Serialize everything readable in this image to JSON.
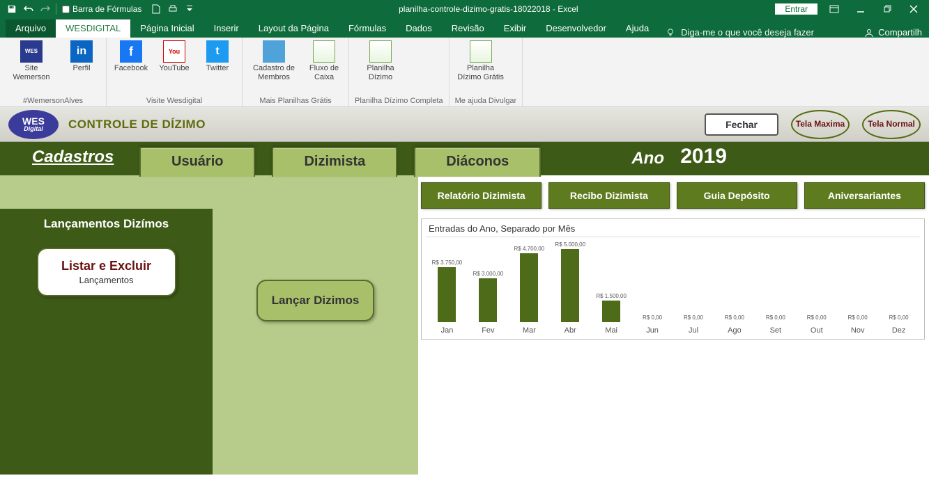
{
  "titlebar": {
    "formula_checkbox_label": "Barra de Fórmulas",
    "document_title": "planilha-controle-dizimo-gratis-18022018  -  Excel",
    "signin": "Entrar"
  },
  "tabs": {
    "file": "Arquivo",
    "active": "WESDIGITAL",
    "others": [
      "Página Inicial",
      "Inserir",
      "Layout da Página",
      "Fórmulas",
      "Dados",
      "Revisão",
      "Exibir",
      "Desenvolvedor",
      "Ajuda"
    ],
    "tellme": "Diga-me o que você deseja fazer",
    "share": "Compartilh"
  },
  "ribbon": {
    "groups": [
      {
        "label": "#WemersonAlves",
        "items": [
          {
            "name": "Site Wemerson",
            "iconText": "WES",
            "cls": "ic-wes",
            "wide": true
          },
          {
            "name": "Perfil",
            "iconText": "in",
            "cls": "ic-in"
          }
        ]
      },
      {
        "label": "Visite Wesdigital",
        "items": [
          {
            "name": "Facebook",
            "iconText": "f",
            "cls": "ic-fb"
          },
          {
            "name": "YouTube",
            "iconText": "You",
            "cls": "ic-yt"
          },
          {
            "name": "Twitter",
            "iconText": "t",
            "cls": "ic-tw"
          }
        ]
      },
      {
        "label": "Mais Planilhas Grátis",
        "items": [
          {
            "name": "Cadastro de Membros",
            "iconText": "",
            "cls": "ic-blue",
            "wide": true
          },
          {
            "name": "Fluxo de Caixa",
            "iconText": "",
            "cls": "ic-sheet"
          }
        ]
      },
      {
        "label": "Planilha Dízimo Completa",
        "items": [
          {
            "name": "Planilha Dízimo",
            "iconText": "",
            "cls": "ic-sheet",
            "wide": true
          }
        ]
      },
      {
        "label": "Me ajuda Divulgar",
        "items": [
          {
            "name": "Planilha Dízimo Grátis",
            "iconText": "",
            "cls": "ic-sheet",
            "wide": true
          }
        ]
      }
    ]
  },
  "sheet_header": {
    "logo_main": "WES",
    "logo_sub": "Digital",
    "title": "CONTROLE DE DÍZIMO",
    "fechar": "Fechar",
    "tela_maxima": "Tela Maxima",
    "tela_normal": "Tela Normal"
  },
  "green_row": {
    "cadastros": "Cadastros",
    "tabs": [
      "Usuário",
      "Dizimista",
      "Diáconos"
    ],
    "ano_label": "Ano",
    "ano_value": "2019"
  },
  "left": {
    "title": "Lançamentos Dizímos",
    "btn_title": "Listar e Excluir",
    "btn_sub": "Lançamentos"
  },
  "mid": {
    "btn": "Lançar Dizimos"
  },
  "actions": [
    "Relatório Dizimista",
    "Recibo Dizimista",
    "Guia Depósito",
    "Aniversariantes"
  ],
  "chart_data": {
    "type": "bar",
    "title": "Entradas do Ano, Separado por Mês",
    "categories": [
      "Jan",
      "Fev",
      "Mar",
      "Abr",
      "Mai",
      "Jun",
      "Jul",
      "Ago",
      "Set",
      "Out",
      "Nov",
      "Dez"
    ],
    "values": [
      3750,
      3000,
      4700,
      5000,
      1500,
      0,
      0,
      0,
      0,
      0,
      0,
      0
    ],
    "labels": [
      "R$ 3.750,00",
      "R$ 3.000,00",
      "R$ 4.700,00",
      "R$ 5.000,00",
      "R$ 1.500,00",
      "R$ 0,00",
      "R$ 0,00",
      "R$ 0,00",
      "R$ 0,00",
      "R$ 0,00",
      "R$ 0,00",
      "R$ 0,00"
    ],
    "ymax": 5000
  }
}
